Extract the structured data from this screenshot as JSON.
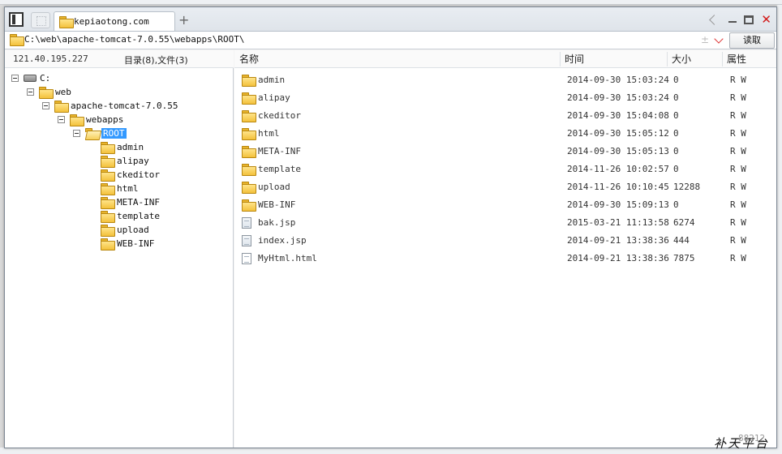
{
  "tab": {
    "title": "kepiaotong.com"
  },
  "address": {
    "path": "C:\\web\\apache-tomcat-7.0.55\\webapps\\ROOT\\",
    "extra_glyph": "±",
    "read_button": "读取"
  },
  "left_header": {
    "ip": "121.40.195.227",
    "counts": "目录(8),文件(3)"
  },
  "tree": [
    {
      "label": "C:",
      "icon": "drive-icon",
      "expandable": true,
      "depth": 0,
      "selected": false
    },
    {
      "label": "web",
      "icon": "folder-icon",
      "expandable": true,
      "depth": 1,
      "selected": false
    },
    {
      "label": "apache-tomcat-7.0.55",
      "icon": "folder-icon",
      "expandable": true,
      "depth": 2,
      "selected": false
    },
    {
      "label": "webapps",
      "icon": "folder-icon",
      "expandable": true,
      "depth": 3,
      "selected": false
    },
    {
      "label": "ROOT",
      "icon": "folder-open-icon",
      "expandable": true,
      "depth": 4,
      "selected": true
    },
    {
      "label": "admin",
      "icon": "folder-icon",
      "expandable": false,
      "depth": 5,
      "selected": false
    },
    {
      "label": "alipay",
      "icon": "folder-icon",
      "expandable": false,
      "depth": 5,
      "selected": false
    },
    {
      "label": "ckeditor",
      "icon": "folder-icon",
      "expandable": false,
      "depth": 5,
      "selected": false
    },
    {
      "label": "html",
      "icon": "folder-icon",
      "expandable": false,
      "depth": 5,
      "selected": false
    },
    {
      "label": "META-INF",
      "icon": "folder-icon",
      "expandable": false,
      "depth": 5,
      "selected": false
    },
    {
      "label": "template",
      "icon": "folder-icon",
      "expandable": false,
      "depth": 5,
      "selected": false
    },
    {
      "label": "upload",
      "icon": "folder-icon",
      "expandable": false,
      "depth": 5,
      "selected": false
    },
    {
      "label": "WEB-INF",
      "icon": "folder-icon",
      "expandable": false,
      "depth": 5,
      "selected": false
    }
  ],
  "columns": {
    "name": "名称",
    "time": "时间",
    "size": "大小",
    "attr": "属性"
  },
  "files": [
    {
      "name": "admin",
      "type": "folder",
      "time": "2014-09-30 15:03:24",
      "size": "0",
      "attr": "R W"
    },
    {
      "name": "alipay",
      "type": "folder",
      "time": "2014-09-30 15:03:24",
      "size": "0",
      "attr": "R W"
    },
    {
      "name": "ckeditor",
      "type": "folder",
      "time": "2014-09-30 15:04:08",
      "size": "0",
      "attr": "R W"
    },
    {
      "name": "html",
      "type": "folder",
      "time": "2014-09-30 15:05:12",
      "size": "0",
      "attr": "R W"
    },
    {
      "name": "META-INF",
      "type": "folder",
      "time": "2014-09-30 15:05:13",
      "size": "0",
      "attr": "R W"
    },
    {
      "name": "template",
      "type": "folder",
      "time": "2014-11-26 10:02:57",
      "size": "0",
      "attr": "R W"
    },
    {
      "name": "upload",
      "type": "folder",
      "time": "2014-11-26 10:10:45",
      "size": "12288",
      "attr": "R W"
    },
    {
      "name": "WEB-INF",
      "type": "folder",
      "time": "2014-09-30 15:09:13",
      "size": "0",
      "attr": "R W"
    },
    {
      "name": "bak.jsp",
      "type": "jsp",
      "time": "2015-03-21 11:13:58",
      "size": "6274",
      "attr": "R W"
    },
    {
      "name": "index.jsp",
      "type": "jsp",
      "time": "2014-09-21 13:38:36",
      "size": "444",
      "attr": "R W"
    },
    {
      "name": "MyHtml.html",
      "type": "html",
      "time": "2014-09-21 13:38:36",
      "size": "7875",
      "attr": "R W"
    }
  ],
  "watermark": {
    "text": "补天平台",
    "number": "88212"
  },
  "colors": {
    "selection": "#3399ff",
    "close": "#d21a1a",
    "folder": "#f3c13b"
  }
}
